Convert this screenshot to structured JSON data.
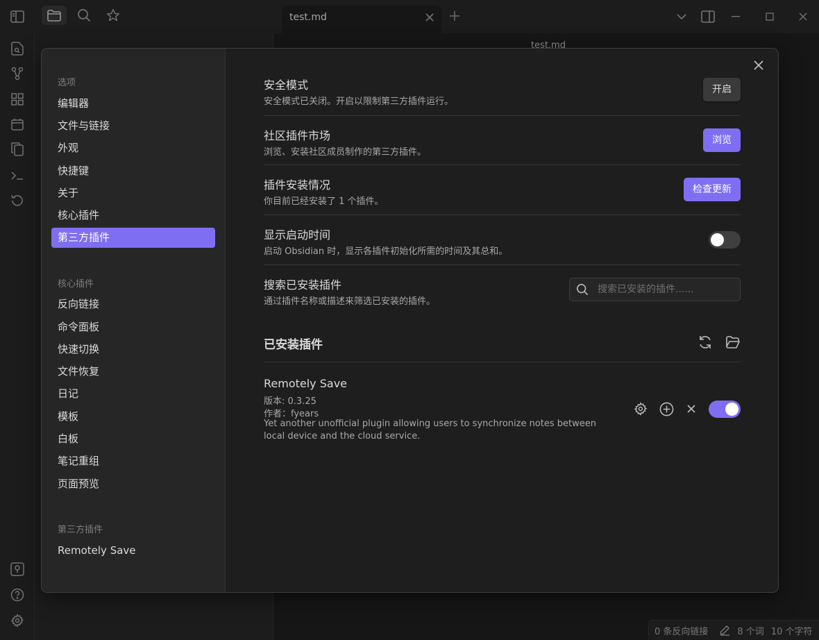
{
  "titlebar": {
    "tab_title": "test.md"
  },
  "behind": {
    "view_title": "test.md"
  },
  "statusbar": {
    "backlinks": "0 条反向链接",
    "words": "8 个词",
    "chars": "10 个字符"
  },
  "nav": {
    "sections": [
      {
        "heading": "选项",
        "items": [
          "编辑器",
          "文件与链接",
          "外观",
          "快捷键",
          "关于",
          "核心插件",
          "第三方插件"
        ]
      },
      {
        "heading": "核心插件",
        "items": [
          "反向链接",
          "命令面板",
          "快速切换",
          "文件恢复",
          "日记",
          "模板",
          "白板",
          "笔记重组",
          "页面预览"
        ]
      },
      {
        "heading": "第三方插件",
        "items": [
          "Remotely Save"
        ]
      }
    ],
    "active_item": "第三方插件"
  },
  "settings": {
    "safe_mode": {
      "name": "安全模式",
      "desc": "安全模式已关闭。开启以限制第三方插件运行。",
      "button": "开启"
    },
    "community": {
      "name": "社区插件市场",
      "desc": "浏览、安装社区成员制作的第三方插件。",
      "button": "浏览"
    },
    "installed_status": {
      "name": "插件安装情况",
      "desc": "你目前已经安装了 1 个插件。",
      "button": "检查更新"
    },
    "startup_time": {
      "name": "显示启动时间",
      "desc": "启动 Obsidian 时，显示各插件初始化所需的时间及其总和。",
      "enabled": false
    },
    "search": {
      "name": "搜索已安装插件",
      "desc": "通过插件名称或描述来筛选已安装的插件。",
      "placeholder": "搜索已安装的插件......",
      "value": ""
    }
  },
  "installed": {
    "heading": "已安装插件",
    "plugins": [
      {
        "name": "Remotely Save",
        "version": "版本: 0.3.25",
        "author": "作者：fyears",
        "description": "Yet another unofficial plugin allowing users to synchronize notes between local device and the cloud service.",
        "enabled": true
      }
    ]
  },
  "colors": {
    "accent": "#7f6df2",
    "background": "#1e1e1e",
    "panel": "#262626"
  }
}
